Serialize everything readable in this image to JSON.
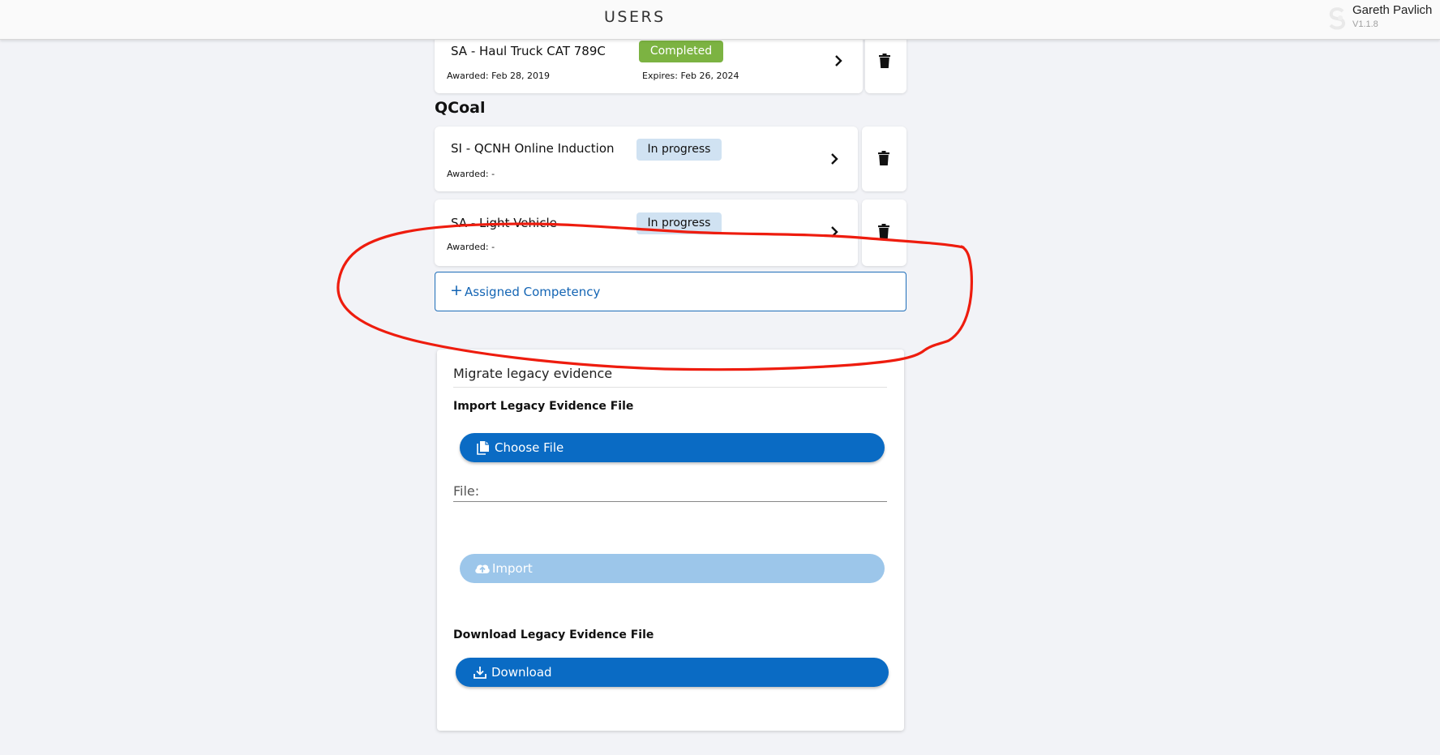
{
  "header": {
    "title": "USERS",
    "user_name": "Gareth Pavlich",
    "version": "V1.1.8"
  },
  "competencies_top": [
    {
      "title": "SA - Haul Truck CAT 789C",
      "status": "Completed",
      "awarded": "Awarded: Feb 28, 2019",
      "expires": "Expires: Feb 26, 2024"
    }
  ],
  "group": {
    "name": "QCoal",
    "items": [
      {
        "title": "SI - QCNH Online Induction",
        "status": "In progress",
        "awarded": "Awarded: -"
      },
      {
        "title": "SA - Light Vehicle",
        "status": "In progress",
        "awarded": "Awarded: -"
      }
    ]
  },
  "assign_button": {
    "plus": "+",
    "label": "Assigned Competency"
  },
  "migrate": {
    "title": "Migrate legacy evidence",
    "import_label": "Import Legacy Evidence File",
    "choose_file": "Choose File",
    "file_label": "File:",
    "import_button": "Import",
    "download_label": "Download Legacy Evidence File",
    "download_button": "Download"
  },
  "icons": {
    "chevron": "chevron-right-icon",
    "trash": "trash-icon",
    "file": "file-copy-icon",
    "upload": "cloud-upload-icon",
    "download": "download-icon",
    "logo": "user-logo-icon"
  },
  "colors": {
    "primary": "#0a6bc4",
    "completed": "#7cb342",
    "in_progress": "#d0e2f2",
    "annotation": "#ee1c0e",
    "disabled": "#9cc6ea"
  }
}
